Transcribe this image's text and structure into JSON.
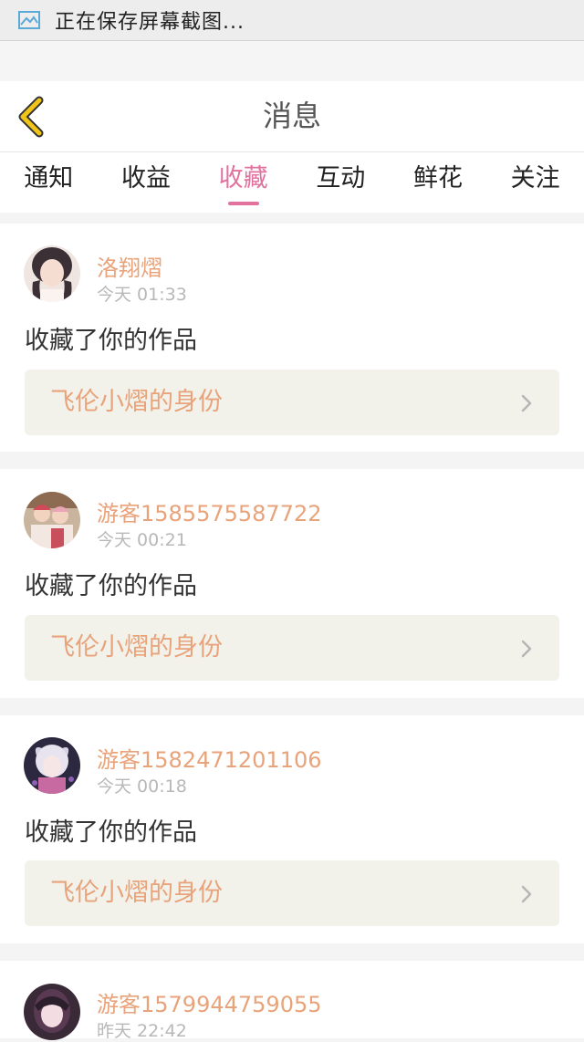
{
  "status_bar": {
    "notification": "正在保存屏幕截图...",
    "icon": "screenshot-icon"
  },
  "header": {
    "title": "消息",
    "back_icon": "chevron-left-icon"
  },
  "tabs": [
    {
      "label": "通知",
      "active": false
    },
    {
      "label": "收益",
      "active": false
    },
    {
      "label": "收藏",
      "active": true
    },
    {
      "label": "互动",
      "active": false
    },
    {
      "label": "鲜花",
      "active": false
    },
    {
      "label": "关注",
      "active": false
    }
  ],
  "messages": [
    {
      "user": "洛翔熠",
      "time": "今天 01:33",
      "action": "收藏了你的作品",
      "work": "飞伦小熠的身份"
    },
    {
      "user": "游客1585575587722",
      "time": "今天 00:21",
      "action": "收藏了你的作品",
      "work": "飞伦小熠的身份"
    },
    {
      "user": "游客1582471201106",
      "time": "今天 00:18",
      "action": "收藏了你的作品",
      "work": "飞伦小熠的身份"
    },
    {
      "user": "游客1579944759055",
      "time": "昨天 22:42"
    }
  ],
  "colors": {
    "accent": "#e2719e",
    "name": "#e8a37a",
    "back_arrow": "#f0c419"
  }
}
